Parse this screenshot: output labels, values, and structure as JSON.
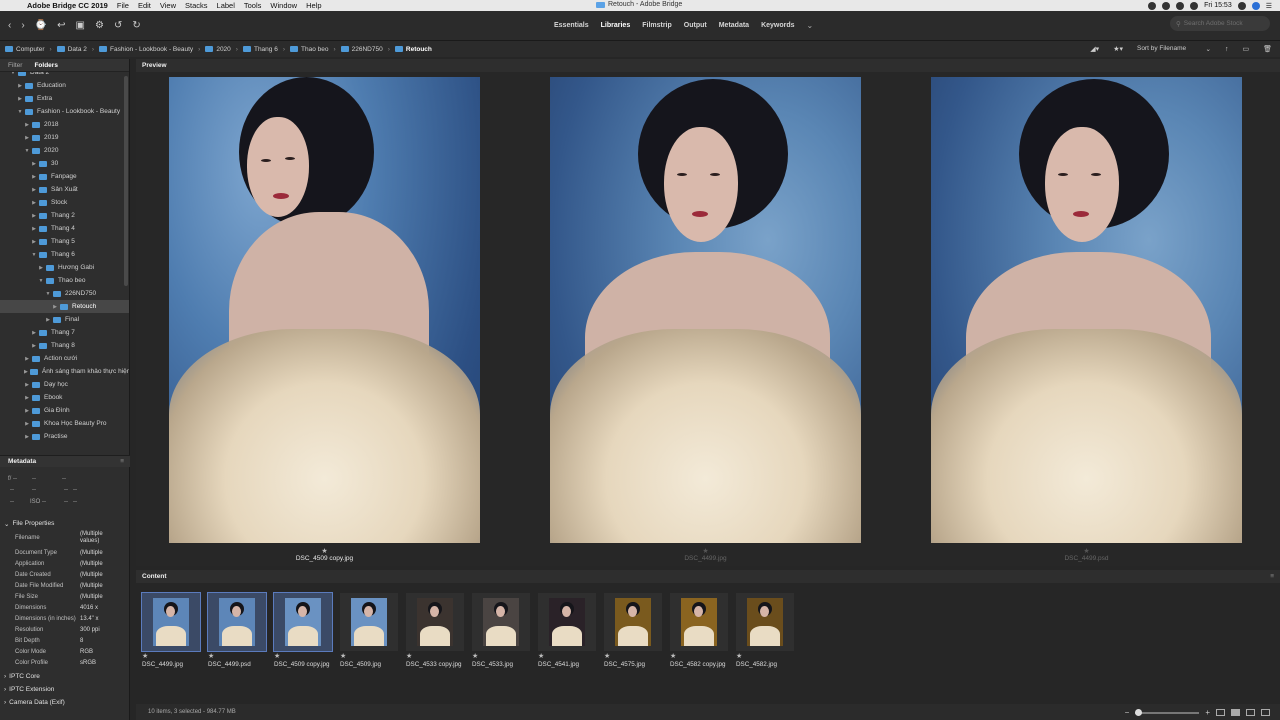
{
  "menubar": {
    "app_name": "Adobe Bridge CC 2019",
    "items": [
      "File",
      "Edit",
      "View",
      "Stacks",
      "Label",
      "Tools",
      "Window",
      "Help"
    ],
    "window_title": "Retouch - Adobe Bridge",
    "clock": "Fri 15:53"
  },
  "workspaces": [
    "Essentials",
    "Libraries",
    "Filmstrip",
    "Output",
    "Metadata",
    "Keywords"
  ],
  "active_workspace": "Libraries",
  "stock_search": {
    "placeholder": "Search Adobe Stock"
  },
  "path": [
    "Computer",
    "Data 2",
    "Fashion - Lookbook - Beauty",
    "2020",
    "Thang 6",
    "Thao beo",
    "226ND750",
    "Retouch"
  ],
  "sort": {
    "label": "Sort by Filename"
  },
  "left_tabs": [
    "Filter",
    "Folders"
  ],
  "active_left_tab": "Folders",
  "folders": [
    {
      "label": "Data 2",
      "depth": 1,
      "expanded": true
    },
    {
      "label": "Education",
      "depth": 2,
      "expanded": false
    },
    {
      "label": "Extra",
      "depth": 2,
      "expanded": false
    },
    {
      "label": "Fashion - Lookbook - Beauty",
      "depth": 2,
      "expanded": true
    },
    {
      "label": "2018",
      "depth": 3,
      "expanded": false
    },
    {
      "label": "2019",
      "depth": 3,
      "expanded": false
    },
    {
      "label": "2020",
      "depth": 3,
      "expanded": true
    },
    {
      "label": "30",
      "depth": 4,
      "expanded": false
    },
    {
      "label": "Fanpage",
      "depth": 4,
      "expanded": false
    },
    {
      "label": "Sản Xuất",
      "depth": 4,
      "expanded": false
    },
    {
      "label": "Stock",
      "depth": 4,
      "expanded": false
    },
    {
      "label": "Thang 2",
      "depth": 4,
      "expanded": false
    },
    {
      "label": "Thang 4",
      "depth": 4,
      "expanded": false
    },
    {
      "label": "Thang 5",
      "depth": 4,
      "expanded": false
    },
    {
      "label": "Thang 6",
      "depth": 4,
      "expanded": true
    },
    {
      "label": "Hương Gabi",
      "depth": 5,
      "expanded": false
    },
    {
      "label": "Thao beo",
      "depth": 5,
      "expanded": true
    },
    {
      "label": "226ND750",
      "depth": 6,
      "expanded": true
    },
    {
      "label": "Retouch",
      "depth": 7,
      "expanded": false,
      "selected": true
    },
    {
      "label": "Final",
      "depth": 6,
      "expanded": false
    },
    {
      "label": "Thang 7",
      "depth": 4,
      "expanded": false
    },
    {
      "label": "Thang 8",
      "depth": 4,
      "expanded": false
    },
    {
      "label": "Action cưới",
      "depth": 3,
      "expanded": false
    },
    {
      "label": "Ánh sáng tham khảo thực hiện",
      "depth": 3,
      "expanded": false
    },
    {
      "label": "Dạy học",
      "depth": 3,
      "expanded": false
    },
    {
      "label": "Ebook",
      "depth": 3,
      "expanded": false
    },
    {
      "label": "Gia Đình",
      "depth": 3,
      "expanded": false
    },
    {
      "label": "Khoa Học Beauty Pro",
      "depth": 3,
      "expanded": false
    },
    {
      "label": "Practise",
      "depth": 3,
      "expanded": false
    }
  ],
  "metadata_panel": {
    "title": "Metadata",
    "exif": {
      "aperture": "f/ --",
      "shutter": "--",
      "r1": "--",
      "r2": "--",
      "r3": "--",
      "iso": "ISO --",
      "r4": "--",
      "r5": "--",
      "r6": "--",
      "r7": "--",
      "r8": "--"
    },
    "file_properties_title": "File Properties",
    "file_properties": [
      {
        "key": "Filename",
        "value": "(Multiple values)",
        "tall": true
      },
      {
        "key": "Document Type",
        "value": "(Multiple"
      },
      {
        "key": "Application",
        "value": "(Multiple"
      },
      {
        "key": "Date Created",
        "value": "(Multiple"
      },
      {
        "key": "Date File Modified",
        "value": "(Multiple"
      },
      {
        "key": "File Size",
        "value": "(Multiple"
      },
      {
        "key": "Dimensions",
        "value": "4016 x"
      },
      {
        "key": "Dimensions (in inches)",
        "value": "13.4\" x"
      },
      {
        "key": "Resolution",
        "value": "300 ppi"
      },
      {
        "key": "Bit Depth",
        "value": "8"
      },
      {
        "key": "Color Mode",
        "value": "RGB"
      },
      {
        "key": "Color Profile",
        "value": "sRGB"
      }
    ],
    "sections": [
      "IPTC Core",
      "IPTC Extension",
      "Camera Data (Exif)"
    ]
  },
  "preview": {
    "title": "Preview",
    "items": [
      {
        "name": "DSC_4509 copy.jpg",
        "active": true
      },
      {
        "name": "DSC_4499.jpg",
        "active": false
      },
      {
        "name": "DSC_4499.psd",
        "active": false
      }
    ]
  },
  "content": {
    "title": "Content",
    "thumbs": [
      {
        "name": "DSC_4499.jpg",
        "selected": true,
        "tone": "#5d86b8"
      },
      {
        "name": "DSC_4499.psd",
        "selected": true,
        "tone": "#5d86b8"
      },
      {
        "name": "DSC_4509 copy.jpg",
        "selected": true,
        "tone": "#6a92c2"
      },
      {
        "name": "DSC_4509.jpg",
        "selected": false,
        "tone": "#6a92c2"
      },
      {
        "name": "DSC_4533 copy.jpg",
        "selected": false,
        "tone": "#3b332f"
      },
      {
        "name": "DSC_4533.jpg",
        "selected": false,
        "tone": "#4a4442"
      },
      {
        "name": "DSC_4541.jpg",
        "selected": false,
        "tone": "#2a2228"
      },
      {
        "name": "DSC_4575.jpg",
        "selected": false,
        "tone": "#7a5a1e"
      },
      {
        "name": "DSC_4582 copy.jpg",
        "selected": false,
        "tone": "#8a6420"
      },
      {
        "name": "DSC_4582.jpg",
        "selected": false,
        "tone": "#6a4d1c"
      }
    ]
  },
  "status": {
    "text": "10 items, 3 selected - 984.77 MB"
  },
  "colors": {
    "folder": "#4e9ad8",
    "selection": "#3b4a66",
    "accent": "#5b7bbd"
  }
}
